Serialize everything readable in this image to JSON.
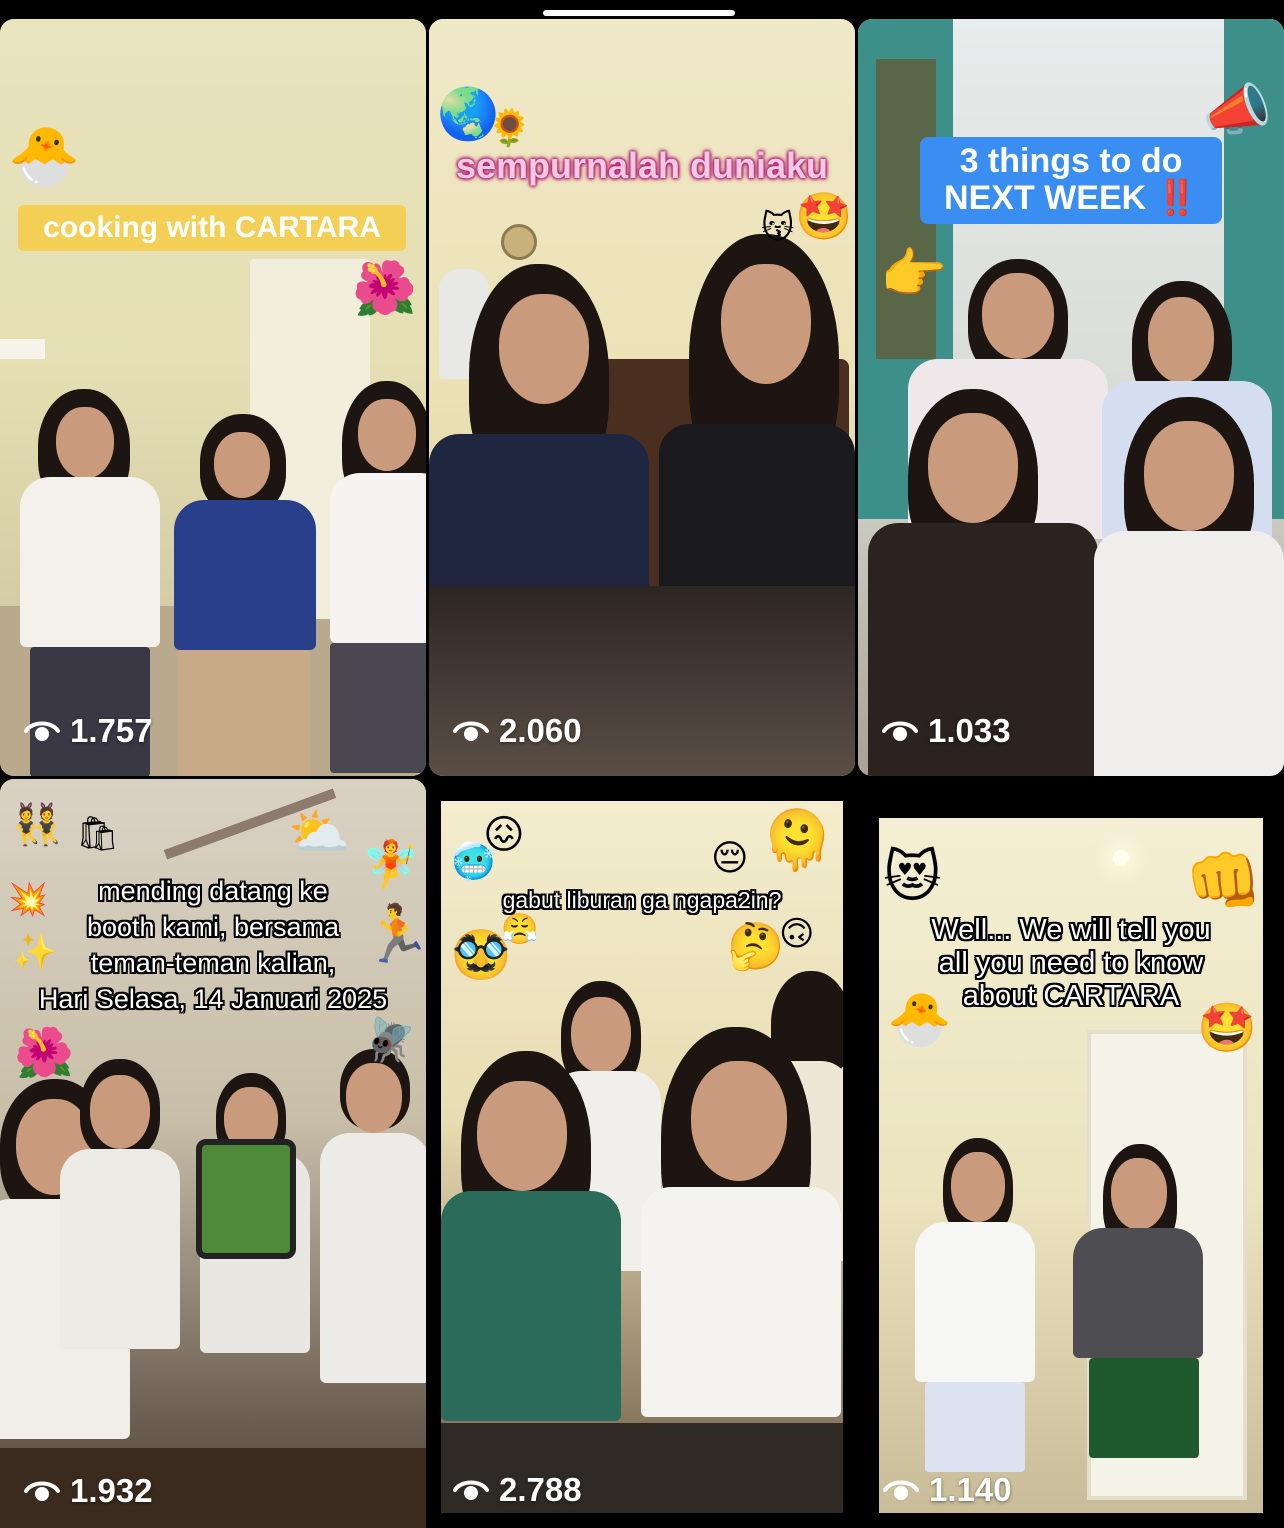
{
  "videos": [
    {
      "caption": "cooking with CARTARA",
      "views": "1.757",
      "emojis": [
        "chick",
        "hibiscus"
      ]
    },
    {
      "caption": "sempurnalah duniaku",
      "views": "2.060",
      "emojis": [
        "globe",
        "sunflower",
        "kissing-cat",
        "star-struck"
      ]
    },
    {
      "caption_line1": "3 things to do",
      "caption_line2": "NEXT WEEK ‼️",
      "views": "1.033",
      "emojis": [
        "megaphone",
        "pointing-hand"
      ]
    },
    {
      "caption_lines": [
        "mending datang ke",
        "booth kami, bersama",
        "teman-teman kalian,",
        "Hari Selasa, 14 Januari 2025"
      ],
      "views": "1.932",
      "emojis": [
        "dancers",
        "shopping-bags",
        "sun-behind-cloud",
        "fairy",
        "collision",
        "sparkles",
        "runner",
        "hibiscus",
        "fly"
      ]
    },
    {
      "caption": "gabut liburan ga ngapa2in?",
      "views": "2.788",
      "emojis": [
        "confounded",
        "cold-face",
        "pensive",
        "melting",
        "steam-nose",
        "disguised",
        "thinking",
        "upside-down"
      ]
    },
    {
      "caption_lines": [
        "Well... We will tell you",
        "all you need to know",
        "about CARTARA"
      ],
      "views": "1.140",
      "emojis": [
        "heart-eyes-cat",
        "fist",
        "chick",
        "star-struck"
      ]
    }
  ],
  "emoji_glyphs": {
    "chick": "🐣",
    "hibiscus": "🌺",
    "globe": "🌏",
    "sunflower": "🌻",
    "kissing-cat": "😽",
    "star-struck": "🤩",
    "megaphone": "📣",
    "pointing-hand": "👉",
    "dancers": "👯",
    "shopping-bags": "🛍",
    "sun-behind-cloud": "⛅",
    "fairy": "🧚",
    "collision": "💥",
    "sparkles": "✨",
    "runner": "🏃",
    "fly": "🪰",
    "confounded": "😖",
    "cold-face": "🥶",
    "pensive": "😔",
    "melting": "🫠",
    "steam-nose": "😤",
    "disguised": "🥸",
    "thinking": "🤔",
    "upside-down": "🙃",
    "heart-eyes-cat": "😻",
    "fist": "👊"
  },
  "colors": {
    "background": "#000000",
    "caption_yellow": "#f3cf55",
    "caption_blue": "#3a8ef2",
    "caption_pink_text": "#f7c8e6"
  }
}
